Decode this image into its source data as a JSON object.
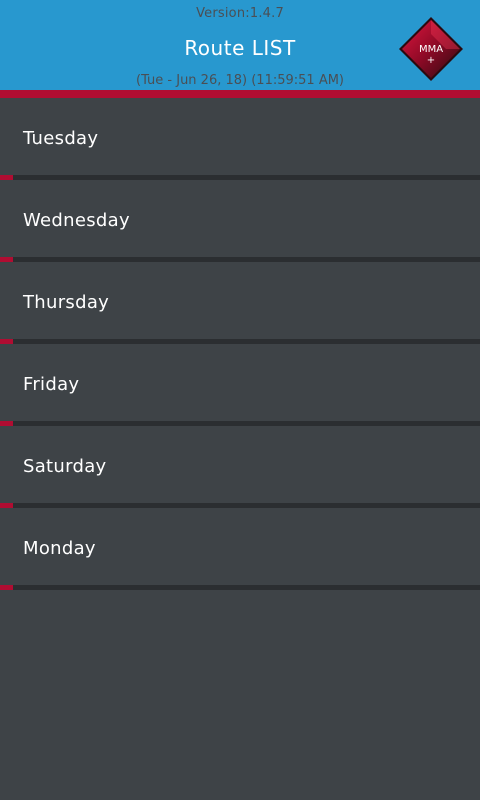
{
  "header": {
    "version": "Version:1.4.7",
    "title": "Route LIST",
    "timestamp": "(Tue - Jun 26, 18) (11:59:51 AM)",
    "logo_text": "MMA",
    "logo_plus": "+"
  },
  "colors": {
    "header_bg": "#2898cf",
    "accent": "#b00d32",
    "list_bg": "#3e4347",
    "divider": "#2b2e31",
    "text_primary": "#ffffff",
    "text_muted": "#4a4f55"
  },
  "routes": [
    {
      "label": "Tuesday"
    },
    {
      "label": "Wednesday"
    },
    {
      "label": "Thursday"
    },
    {
      "label": "Friday"
    },
    {
      "label": "Saturday"
    },
    {
      "label": "Monday"
    }
  ]
}
